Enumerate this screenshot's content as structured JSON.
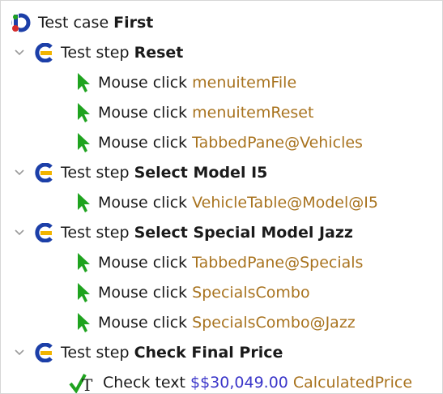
{
  "tree": {
    "root": {
      "icon": "test-case-icon",
      "kind": "Test case",
      "name": "First"
    },
    "steps": [
      {
        "icon": "test-step-icon",
        "kind": "Test step",
        "name": "Reset",
        "actions": [
          {
            "icon": "mouse-click-icon",
            "kind": "Mouse click",
            "target": "menuitemFile"
          },
          {
            "icon": "mouse-click-icon",
            "kind": "Mouse click",
            "target": "menuitemReset"
          },
          {
            "icon": "mouse-click-icon",
            "kind": "Mouse click",
            "target": "TabbedPane@Vehicles"
          }
        ]
      },
      {
        "icon": "test-step-icon",
        "kind": "Test step",
        "name": "Select Model I5",
        "actions": [
          {
            "icon": "mouse-click-icon",
            "kind": "Mouse click",
            "target": "VehicleTable@Model@I5"
          }
        ]
      },
      {
        "icon": "test-step-icon",
        "kind": "Test step",
        "name": "Select Special Model Jazz",
        "actions": [
          {
            "icon": "mouse-click-icon",
            "kind": "Mouse click",
            "target": "TabbedPane@Specials"
          },
          {
            "icon": "mouse-click-icon",
            "kind": "Mouse click",
            "target": "SpecialsCombo"
          },
          {
            "icon": "mouse-click-icon",
            "kind": "Mouse click",
            "target": "SpecialsCombo@Jazz"
          }
        ]
      },
      {
        "icon": "test-step-icon",
        "kind": "Test step",
        "name": "Check Final Price",
        "actions": [
          {
            "icon": "check-text-icon",
            "kind": "Check text",
            "value": "$$30,049.00",
            "target": "CalculatedPrice"
          }
        ]
      }
    ]
  },
  "colors": {
    "target_text": "#a8731f",
    "value_text": "#3b36c9",
    "cursor_green": "#1fa31f",
    "step_blue": "#1c3fa8",
    "step_yellow": "#f2b400"
  }
}
